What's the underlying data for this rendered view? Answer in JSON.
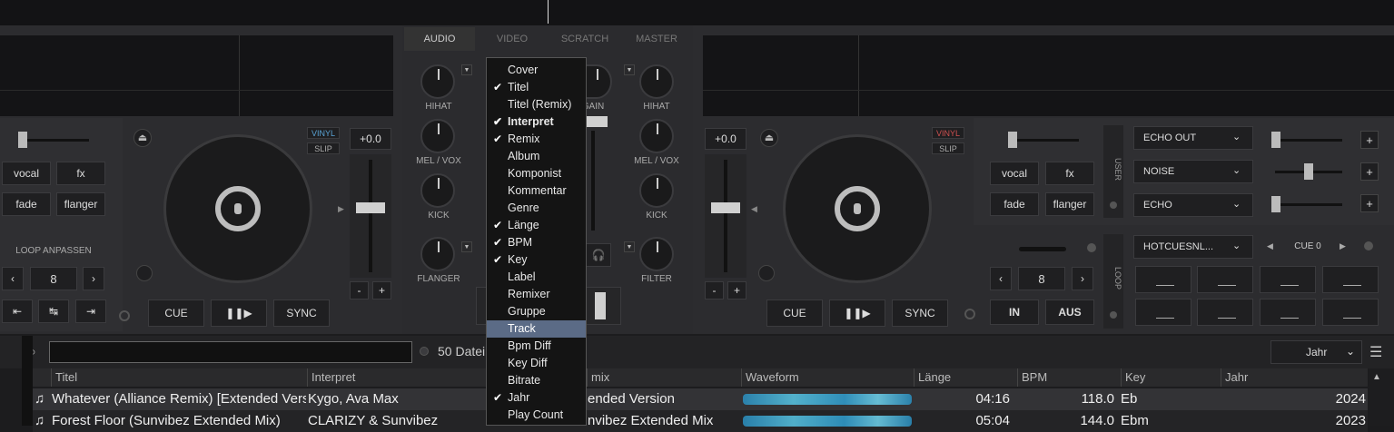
{
  "mixer_tabs": [
    "AUDIO",
    "VIDEO",
    "SCRATCH",
    "MASTER"
  ],
  "deck_left": {
    "vinyl": "VINYL",
    "slip": "SLIP",
    "pitch": "+0.0",
    "fx_buttons": [
      "vocal",
      "fx",
      "fade",
      "flanger"
    ],
    "loop_label": "LOOP ANPASSEN",
    "loop_value": "8",
    "cue": "CUE",
    "play": "❚❚▶",
    "sync": "SYNC",
    "minus": "-",
    "plus": "+"
  },
  "deck_right": {
    "vinyl": "VINYL",
    "slip": "SLIP",
    "pitch": "+0.0",
    "fx_buttons": [
      "vocal",
      "fx",
      "fade",
      "flanger"
    ],
    "user_label": "USER",
    "loop_label": "LOOP",
    "loop_value": "8",
    "in": "IN",
    "aus": "AUS",
    "cue": "CUE",
    "play": "❚❚▶",
    "sync": "SYNC",
    "minus": "-",
    "plus": "+",
    "fx_slots": [
      "ECHO OUT",
      "NOISE",
      "ECHO"
    ],
    "hotcues_select": "HOTCUESNL...",
    "cue_nav": "CUE 0"
  },
  "mixer_left_knobs": [
    "HIHAT",
    "MEL / VOX",
    "KICK",
    "FLANGER"
  ],
  "mixer_right_knobs": [
    "HIHAT",
    "MEL / VOX",
    "KICK",
    "FILTER"
  ],
  "gain_label": "GAIN",
  "menu_items": [
    {
      "label": "Cover",
      "checked": false
    },
    {
      "label": "Titel",
      "checked": true
    },
    {
      "label": "Titel (Remix)",
      "checked": false
    },
    {
      "label": "Interpret",
      "checked": true,
      "bold": true
    },
    {
      "label": "Remix",
      "checked": true
    },
    {
      "label": "Album",
      "checked": false
    },
    {
      "label": "Komponist",
      "checked": false
    },
    {
      "label": "Kommentar",
      "checked": false
    },
    {
      "label": "Genre",
      "checked": false
    },
    {
      "label": "Länge",
      "checked": true
    },
    {
      "label": "BPM",
      "checked": true
    },
    {
      "label": "Key",
      "checked": true
    },
    {
      "label": "Label",
      "checked": false
    },
    {
      "label": "Remixer",
      "checked": false
    },
    {
      "label": "Gruppe",
      "checked": false
    },
    {
      "label": "Track",
      "checked": false,
      "selected": true
    },
    {
      "label": "Bpm Diff",
      "checked": false
    },
    {
      "label": "Key Diff",
      "checked": false
    },
    {
      "label": "Bitrate",
      "checked": false
    },
    {
      "label": "Jahr",
      "checked": true
    },
    {
      "label": "Play Count",
      "checked": false
    }
  ],
  "library": {
    "search_value": "",
    "file_count": "50 Datei",
    "sort_select": "Jahr",
    "columns": [
      "Titel",
      "Interpret",
      "mix",
      "Waveform",
      "Länge",
      "BPM",
      "Key",
      "Jahr"
    ],
    "rows": [
      {
        "title": "Whatever (Alliance Remix) [Extended Version]",
        "artist": "Kygo, Ava Max",
        "remix": "ended Version",
        "length": "04:16",
        "bpm": "118.0",
        "key": "Eb",
        "year": "2024"
      },
      {
        "title": "Forest Floor (Sunvibez Extended Mix)",
        "artist": "CLARIZY & Sunvibez",
        "remix": "nvibez Extended Mix",
        "length": "05:04",
        "bpm": "144.0",
        "key": "Ebm",
        "year": "2023"
      }
    ]
  }
}
